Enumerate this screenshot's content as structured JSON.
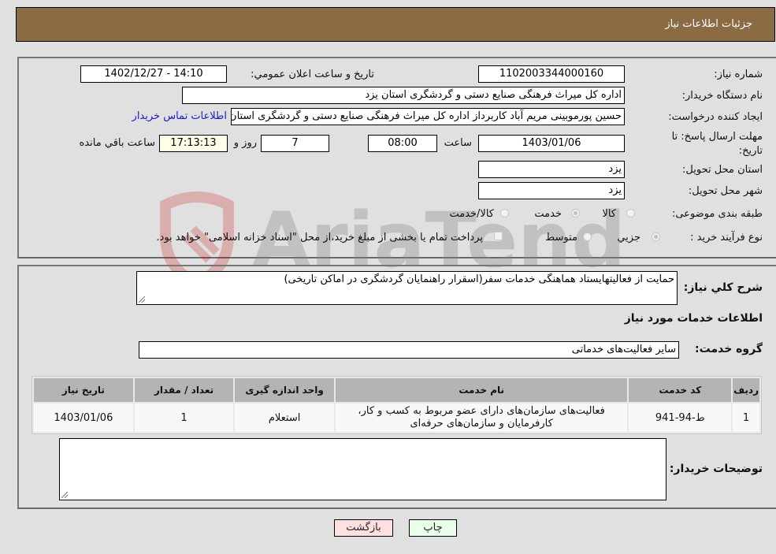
{
  "header": {
    "title": "جزئیات اطلاعات نیاز"
  },
  "form": {
    "need_number_label": "شماره نیاز:",
    "need_number": "1102003344000160",
    "announce_label": "تاریخ و ساعت اعلان عمومي:",
    "announce_value": "1402/12/27 - 14:10",
    "buyer_org_label": "نام دستگاه خریدار:",
    "buyer_org": "اداره کل میراث فرهنگی  صنایع دستی و گردشگری استان یزد",
    "creator_label": "ایجاد کننده درخواست:",
    "creator": "حسین پورموبینی مریم آباد کاربرداز اداره کل میراث فرهنگی  صنایع دستی و گردشگری استان یزد",
    "contact_link": "اطلاعات تماس خریدار",
    "deadline_label": "مهلت ارسال پاسخ: تا تاریخ:",
    "deadline_date": "1403/01/06",
    "time_label": "ساعت",
    "deadline_time": "08:00",
    "days_value": "7",
    "days_label": "روز و",
    "remaining_time": "17:13:13",
    "remaining_label": "ساعت باقي مانده",
    "province_label": "استان محل تحویل:",
    "province": "یزد",
    "city_label": "شهر محل تحویل:",
    "city": "یزد",
    "category_label": "طبقه بندی موضوعی:",
    "category_options": [
      {
        "label": "کالا",
        "checked": false
      },
      {
        "label": "خدمت",
        "checked": true
      },
      {
        "label": "کالا/خدمت",
        "checked": false
      }
    ],
    "process_label": "نوع فرآیند خرید :",
    "process_options": [
      {
        "label": "جزيي",
        "checked": true
      },
      {
        "label": "متوسط",
        "checked": false
      }
    ],
    "treasury_note": "پرداخت تمام یا بخشی از مبلغ خرید،از محل \"اسناد خزانه اسلامی\" خواهد بود."
  },
  "details": {
    "description_label": "شرح کلي نیاز:",
    "description": "حمایت از فعالیتهایستاد هماهنگی خدمات سفر(اسقرار راهنمایان گردشگری در اماکن  تاریخی)",
    "services_heading": "اطلاعات خدمات مورد نیاز",
    "service_group_label": "گروه خدمت:",
    "service_group": "سایر فعالیت‌های خدماتی",
    "table": {
      "headers": [
        "ردیف",
        "کد خدمت",
        "نام خدمت",
        "واحد اندازه گیری",
        "تعداد / مقدار",
        "تاریخ نیاز"
      ],
      "rows": [
        [
          "1",
          "ط-94-941",
          "فعالیت‌های سازمان‌های دارای عضو مربوط به کسب و کار، کارفرمایان و سازمان‌های حرفه‌ای",
          "استعلام",
          "1",
          "1403/01/06"
        ]
      ]
    },
    "buyer_notes_label": "توضیحات خریدار:",
    "buyer_notes": ""
  },
  "buttons": {
    "print": "چاپ",
    "back": "بازگشت"
  },
  "watermark": {
    "text": "AriaTender.neT"
  },
  "colors": {
    "header_bg": "#8b6c42",
    "link": "#1a1ad6",
    "back_bg": "#ffe0e0",
    "print_bg": "#eaffea"
  }
}
